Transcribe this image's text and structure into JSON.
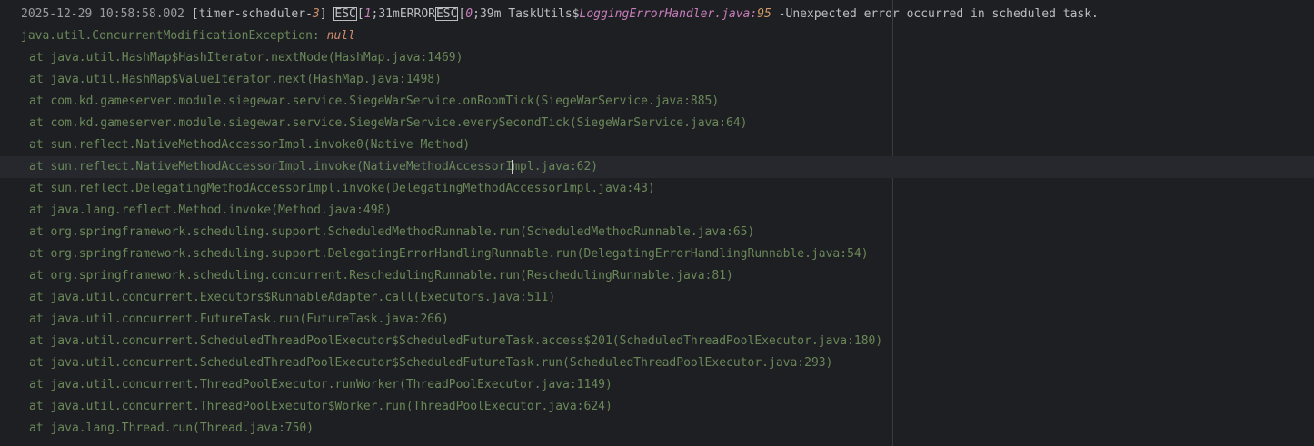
{
  "log_header": {
    "timestamp": "2025-12-29 10:58:58.002",
    "thread_prefix": "[timer-scheduler-",
    "thread_num": "3",
    "thread_suffix": "]",
    "esc1": "ESC",
    "seq1_open": "[",
    "seq1_num": "1",
    "seq1_rest": ";31mERROR",
    "esc2": "ESC",
    "seq2_open": "[",
    "seq2_num": "0",
    "seq2_rest": ";39m TaskUtils$",
    "handler_file": "LoggingErrorHandler.java",
    "handler_colon": ":",
    "handler_line": "95",
    "message": " -Unexpected error occurred in scheduled task."
  },
  "exception": {
    "class": "java.util.ConcurrentModificationException",
    "sep": ": ",
    "message": "null"
  },
  "stack_frames": [
    {
      "prefix": "at ",
      "method": "java.util.HashMap$HashIterator.nextNode",
      "location": "(HashMap.java:1469)"
    },
    {
      "prefix": "at ",
      "method": "java.util.HashMap$ValueIterator.next",
      "location": "(HashMap.java:1498)"
    },
    {
      "prefix": "at ",
      "method": "com.kd.gameserver.module.siegewar.service.SiegeWarService.onRoomTick",
      "location": "(SiegeWarService.java:885)"
    },
    {
      "prefix": "at ",
      "method": "com.kd.gameserver.module.siegewar.service.SiegeWarService.everySecondTick",
      "location": "(SiegeWarService.java:64)"
    },
    {
      "prefix": "at ",
      "method": "sun.reflect.NativeMethodAccessorImpl.invoke0",
      "location": "(Native Method)"
    },
    {
      "prefix": "at ",
      "method": "sun.reflect.NativeMethodAccessorImpl.invoke",
      "location": "(NativeMethodAccessorImpl.java:62)"
    },
    {
      "prefix": "at ",
      "method": "sun.reflect.DelegatingMethodAccessorImpl.invoke",
      "location": "(DelegatingMethodAccessorImpl.java:43)"
    },
    {
      "prefix": "at ",
      "method": "java.lang.reflect.Method.invoke",
      "location": "(Method.java:498)"
    },
    {
      "prefix": "at ",
      "method": "org.springframework.scheduling.support.ScheduledMethodRunnable.run",
      "location": "(ScheduledMethodRunnable.java:65)"
    },
    {
      "prefix": "at ",
      "method": "org.springframework.scheduling.support.DelegatingErrorHandlingRunnable.run",
      "location": "(DelegatingErrorHandlingRunnable.java:54)"
    },
    {
      "prefix": "at ",
      "method": "org.springframework.scheduling.concurrent.ReschedulingRunnable.run",
      "location": "(ReschedulingRunnable.java:81)"
    },
    {
      "prefix": "at ",
      "method": "java.util.concurrent.Executors$RunnableAdapter.call",
      "location": "(Executors.java:511)"
    },
    {
      "prefix": "at ",
      "method": "java.util.concurrent.FutureTask.run",
      "location": "(FutureTask.java:266)"
    },
    {
      "prefix": "at ",
      "method": "java.util.concurrent.ScheduledThreadPoolExecutor$ScheduledFutureTask.access$201",
      "location": "(ScheduledThreadPoolExecutor.java:180)"
    },
    {
      "prefix": "at ",
      "method": "java.util.concurrent.ScheduledThreadPoolExecutor$ScheduledFutureTask.run",
      "location": "(ScheduledThreadPoolExecutor.java:293)"
    },
    {
      "prefix": "at ",
      "method": "java.util.concurrent.ThreadPoolExecutor.runWorker",
      "location": "(ThreadPoolExecutor.java:1149)"
    },
    {
      "prefix": "at ",
      "method": "java.util.concurrent.ThreadPoolExecutor$Worker.run",
      "location": "(ThreadPoolExecutor.java:624)"
    },
    {
      "prefix": "at ",
      "method": "java.lang.Thread.run",
      "location": "(Thread.java:750)"
    }
  ],
  "colors": {
    "background": "#1e1f22",
    "caret_line": "#26282e",
    "stack_text": "#6a8759",
    "italic_purple": "#c77dbb",
    "italic_orange": "#cf8e6d",
    "right_margin": "#393b40"
  }
}
